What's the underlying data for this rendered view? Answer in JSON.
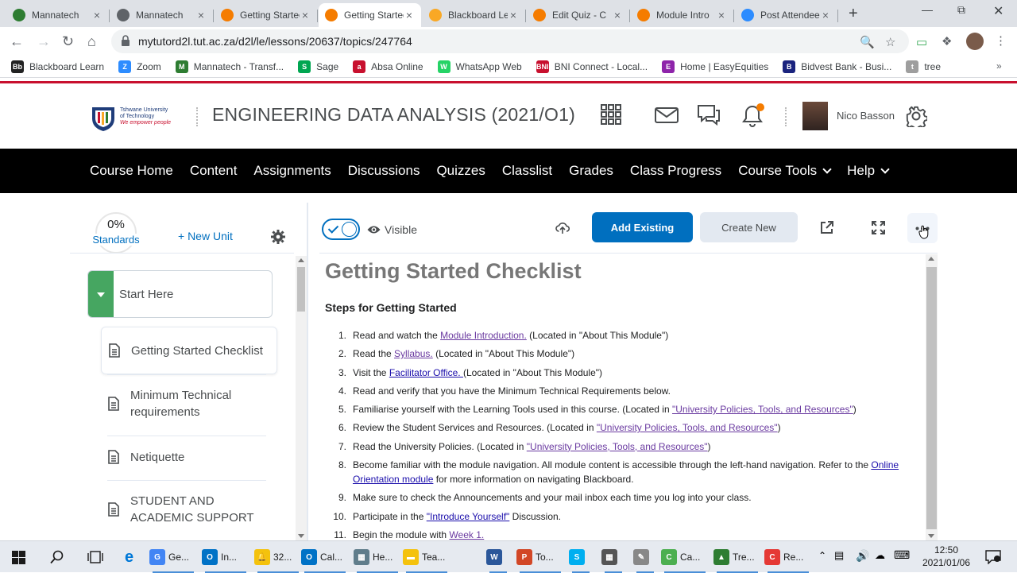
{
  "browser": {
    "tabs": [
      {
        "title": "Mannatech",
        "icon": "mannatech-icon",
        "color": "#2e7d32"
      },
      {
        "title": "Mannatech",
        "icon": "globe-icon",
        "color": "#5f6368"
      },
      {
        "title": "Getting Started",
        "icon": "brightspace-icon",
        "color": "#f57c00"
      },
      {
        "title": "Getting Started",
        "icon": "brightspace-icon",
        "color": "#f57c00",
        "active": true
      },
      {
        "title": "Blackboard Learn",
        "icon": "blackboard-icon",
        "color": "#f9a825"
      },
      {
        "title": "Edit Quiz - C",
        "icon": "brightspace-icon",
        "color": "#f57c00"
      },
      {
        "title": "Module Intro",
        "icon": "brightspace-icon",
        "color": "#f57c00"
      },
      {
        "title": "Post Attendee",
        "icon": "zoom-icon",
        "color": "#2d8cff"
      }
    ],
    "url": "mytutord2l.tut.ac.za/d2l/le/lessons/20637/topics/247764",
    "bookmarks": [
      {
        "label": "Blackboard Learn",
        "color": "#222",
        "glyph": "Bb"
      },
      {
        "label": "Zoom",
        "color": "#2d8cff",
        "glyph": "Z"
      },
      {
        "label": "Mannatech - Transf...",
        "color": "#2e7d32",
        "glyph": "M"
      },
      {
        "label": "Sage",
        "color": "#00a651",
        "glyph": "S"
      },
      {
        "label": "Absa Online",
        "color": "#c8102e",
        "glyph": "a"
      },
      {
        "label": "WhatsApp Web",
        "color": "#25d366",
        "glyph": "W"
      },
      {
        "label": "BNI Connect - Local...",
        "color": "#c8102e",
        "glyph": "BNI"
      },
      {
        "label": "Home | EasyEquities",
        "color": "#8e24aa",
        "glyph": "E"
      },
      {
        "label": "Bidvest Bank - Busi...",
        "color": "#1a237e",
        "glyph": "B"
      },
      {
        "label": "tree",
        "color": "#9e9e9e",
        "glyph": "t"
      }
    ]
  },
  "header": {
    "logo": {
      "line1": "Tshwane University",
      "line2": "of Technology",
      "tagline": "We empower people"
    },
    "course_title": "ENGINEERING DATA ANALYSIS (2021/O1)",
    "user_name": "Nico Basson",
    "notification_color": "#f57c00"
  },
  "nav": {
    "items": [
      {
        "label": "Course Home"
      },
      {
        "label": "Content"
      },
      {
        "label": "Assignments"
      },
      {
        "label": "Discussions"
      },
      {
        "label": "Quizzes"
      },
      {
        "label": "Classlist"
      },
      {
        "label": "Grades"
      },
      {
        "label": "Class Progress"
      },
      {
        "label": "Course Tools",
        "dropdown": true
      },
      {
        "label": "Help",
        "dropdown": true
      }
    ]
  },
  "left_panel": {
    "standards_pct": "0%",
    "standards_label": "Standards",
    "new_unit_label": "+ New Unit",
    "unit_title": "Start Here",
    "topics": [
      {
        "title": "Getting Started Checklist",
        "selected": true
      },
      {
        "title": "Minimum Technical requirements"
      },
      {
        "title": "Netiquette"
      },
      {
        "title": "STUDENT AND ACADEMIC SUPPORT"
      }
    ]
  },
  "toolbar": {
    "visible_label": "Visible",
    "add_existing_label": "Add Existing",
    "create_new_label": "Create New"
  },
  "content": {
    "title": "Getting Started Checklist",
    "subtitle": "Steps for Getting Started",
    "steps": [
      [
        {
          "t": "Read and watch the "
        },
        {
          "t": "Module Introduction.",
          "link": 1
        },
        {
          "t": " (Located in \"About This Module\")"
        }
      ],
      [
        {
          "t": "Read the "
        },
        {
          "t": "Syllabus.",
          "link": 1
        },
        {
          "t": " (Located in \"About This Module\")"
        }
      ],
      [
        {
          "t": "Visit the "
        },
        {
          "t": "Facilitator Office. ",
          "link": 2
        },
        {
          "t": "(Located in \"About This Module\")"
        }
      ],
      [
        {
          "t": "Read and verify that you have the Minimum Technical Requirements below."
        }
      ],
      [
        {
          "t": "Familiarise yourself with the Learning Tools used in this course. (Located in "
        },
        {
          "t": "\"University Policies, Tools, and Resources\"",
          "link": 1
        },
        {
          "t": ")"
        }
      ],
      [
        {
          "t": "Review the Student Services and Resources. (Located in "
        },
        {
          "t": "\"University Policies, Tools, and Resources\"",
          "link": 1
        },
        {
          "t": ")"
        }
      ],
      [
        {
          "t": "Read the University Policies. (Located in "
        },
        {
          "t": "\"University Policies, Tools, and Resources\"",
          "link": 1
        },
        {
          "t": ")"
        }
      ],
      [
        {
          "t": "Become familiar with the module navigation. All module content is accessible through the left-hand navigation. Refer to the "
        },
        {
          "t": "Online Orientation module",
          "link": 2
        },
        {
          "t": " for more information on navigating Blackboard."
        }
      ],
      [
        {
          "t": "Make sure to check the Announcements and your mail inbox each time you log into your class."
        }
      ],
      [
        {
          "t": "Participate in the "
        },
        {
          "t": "\"Introduce Yourself\"",
          "link": 2
        },
        {
          "t": " Discussion."
        }
      ],
      [
        {
          "t": "Begin the module with "
        },
        {
          "t": "Week 1. ",
          "link": 1
        }
      ]
    ]
  },
  "taskbar": {
    "items": [
      {
        "label": "Ge...",
        "color": "#4285f4",
        "glyph": "G"
      },
      {
        "label": "In...",
        "color": "#0072c6",
        "glyph": "O"
      },
      {
        "label": "32...",
        "color": "#f4c20d",
        "glyph": "🔔"
      },
      {
        "label": "Cal...",
        "color": "#0072c6",
        "glyph": "O"
      },
      {
        "label": "He...",
        "color": "#607d8b",
        "glyph": "▦"
      },
      {
        "label": "Tea...",
        "color": "#f4c20d",
        "glyph": "▬"
      },
      {
        "label": "",
        "color": "#2b579a",
        "glyph": "W"
      },
      {
        "label": "To...",
        "color": "#d24726",
        "glyph": "P"
      },
      {
        "label": "",
        "color": "#00aff0",
        "glyph": "S"
      },
      {
        "label": "",
        "color": "#555",
        "glyph": "▦"
      },
      {
        "label": "",
        "color": "#888",
        "glyph": "✎"
      },
      {
        "label": "Ca...",
        "color": "#4caf50",
        "glyph": "C"
      },
      {
        "label": "Tre...",
        "color": "#2e7d32",
        "glyph": "▲"
      },
      {
        "label": "Re...",
        "color": "#e53935",
        "glyph": "C"
      }
    ],
    "time": "12:50",
    "date": "2021/01/06"
  }
}
